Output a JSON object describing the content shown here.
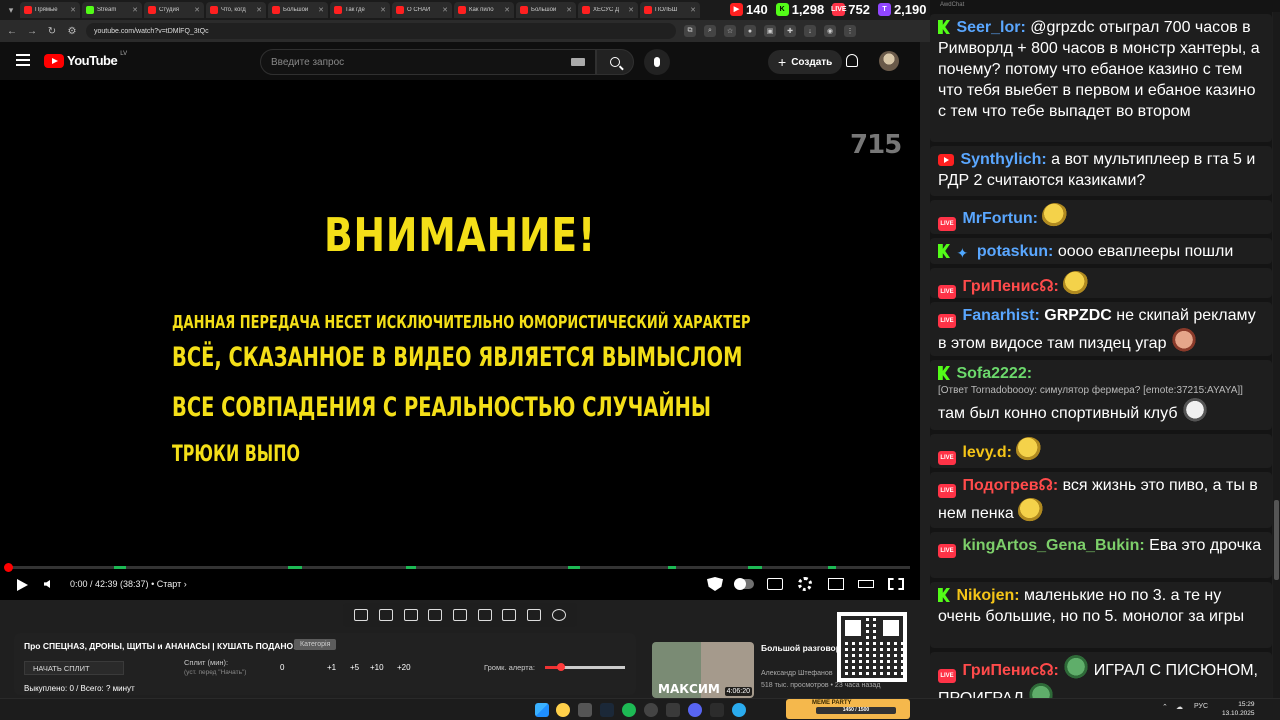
{
  "browser": {
    "tabs": [
      "Прямые",
      "Stream",
      "Студия",
      "Что, когд",
      "Большой",
      "Так где",
      "О СНАЙ",
      "Как пило",
      "Большой",
      "ХЕСУС Д",
      "ПОЛЬШ",
      "ФИНАЛ"
    ],
    "url": "youtube.com/watch?v=tDMlFQ_3tQc"
  },
  "stream_stats": [
    {
      "platform": "youtube",
      "count": "140",
      "color": "#ff2020"
    },
    {
      "platform": "kick",
      "count": "1,298",
      "color": "#53fc18"
    },
    {
      "platform": "vk-live",
      "count": "752",
      "color": "#ff3347"
    },
    {
      "platform": "twitch",
      "count": "2,190",
      "color": "#9146ff"
    }
  ],
  "youtube": {
    "logo_text": "YouTube",
    "region": "LV",
    "search_placeholder": "Введите запрос",
    "create_label": "Создать"
  },
  "video": {
    "watermark": "715",
    "warning_title": "ВНИМАНИЕ!",
    "warning_lines": [
      "ДАННАЯ ПЕРЕДАЧА НЕСЕТ ИСКЛЮЧИТЕЛЬНО ЮМОРИСТИЧЕСКИЙ ХАРАКТЕР",
      "ВСЁ, СКАЗАННОЕ В ВИДЕО ЯВЛЯЕТСЯ ВЫМЫСЛОМ",
      "ВСЕ СОВПАДЕНИЯ С РЕАЛЬНОСТЬЮ СЛУЧАЙНЫ",
      "ТРЮКИ ВЫПО"
    ],
    "time": "0:00 / 42:39 (38:37)",
    "chapter": "• Старт",
    "progress": 0
  },
  "split_panel": {
    "title": "Про СПЕЦНАЗ, ДРОНЫ, ЩИТЫ и АНАНАСЫ | КУШАТЬ ПОДАНО!",
    "category": "Категорія",
    "start_label": "НАЧАТЬ СПЛИТ",
    "split_label": "Сплит (мин):",
    "split_hint": "(уст. перед \"Начать\")",
    "values": [
      "0",
      "+1",
      "+5",
      "+10",
      "+20"
    ],
    "alert_label": "Громк. алерта:",
    "alert_volume": 0.2,
    "total": "Выкуплено: 0 / Всего: ? минут"
  },
  "related": {
    "title": "Большой разговор с Максимом Кацем",
    "channel": "Александр Штефанов",
    "meta": "518 тыс. просмотров • 23 часа назад",
    "thumb_caption": "МАКСИМ",
    "duration": "4:06:20"
  },
  "chat": {
    "header": "AwdChat",
    "messages": [
      {
        "platform": "kick",
        "nick": "Seer_lor:",
        "nick_color": "#5aa7ff",
        "text": "@grpzdc отыграл 700 часов в Римворлд + 800 часов в монстр хантеры, а почему? потому что ебаное казино с тем что тебя выебет в первом и ебаное казино с тем что тебе выпадет во втором"
      },
      {
        "platform": "youtube",
        "nick": "Synthylich:",
        "nick_color": "#5aa7ff",
        "text": "а вот мультиплеер в гта 5 и РДР 2 считаются казиками?"
      },
      {
        "platform": "vk-live",
        "nick": "MrFortun:",
        "nick_color": "#5aa7ff",
        "text": ""
      },
      {
        "platform": "kick",
        "nick": "potaskun:",
        "nick_color": "#5aa7ff",
        "text": "оооо еваплееры пошли"
      },
      {
        "platform": "vk-live",
        "nick": "ГриПенис☊:",
        "nick_color": "#ff4b4b",
        "text": ""
      },
      {
        "platform": "vk-live",
        "nick": "Fanarhist:",
        "nick_color": "#5aa7ff",
        "mention": "GRPZDC",
        "text": "не скипай рекламу в этом видосе там пиздец угар"
      },
      {
        "platform": "kick",
        "nick": "Sofa2222:",
        "nick_color": "#6cd96c",
        "reply": "[Ответ Tornadoboooy: симулятор фермера? [emote:37215:AYAYA]]",
        "text": "там был конно спортивный клуб"
      },
      {
        "platform": "vk-live",
        "nick": "levy.d:",
        "nick_color": "#f5c518",
        "text": ""
      },
      {
        "platform": "vk-live",
        "nick": "Подогрев☊:",
        "nick_color": "#ff4b4b",
        "text": "вся жизнь это пиво, а ты в нем пенка"
      },
      {
        "platform": "vk-live",
        "nick": "kingArtos_Gena_Bukin:",
        "nick_color": "#7dcf6a",
        "text": "Ева это дрочка"
      },
      {
        "platform": "kick",
        "nick": "Nikojen:",
        "nick_color": "#f5c518",
        "text": "маленькие но по 3. а те ну очень большие, но по 5. монолог за игры"
      },
      {
        "platform": "vk-live",
        "nick": "ГриПенис☊:",
        "nick_color": "#ff4b4b",
        "text": "ИГРАЛ С ПИСЮНОМ, ПРОИГРАЛ"
      }
    ]
  },
  "taskbar": {
    "party_label": "MEME PARTY",
    "party_progress": "1450 / 1500",
    "lang": "РУС",
    "time": "15:29",
    "date": "13.10.2025"
  }
}
